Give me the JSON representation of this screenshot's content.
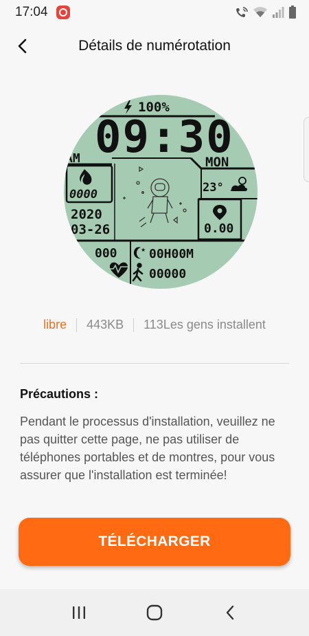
{
  "status_bar": {
    "time": "17:04",
    "icons": [
      "app-notification-icon",
      "wifi-calling-icon",
      "wifi-icon",
      "signal-icon",
      "battery-icon"
    ]
  },
  "app_bar": {
    "title": "Détails de numérotation",
    "back_icon": "chevron-left-icon"
  },
  "watch_face": {
    "battery": "100%",
    "time": "09:30",
    "ampm": "AM",
    "day": "MON",
    "calories": "0000",
    "temperature": "23°",
    "year": "2020",
    "date": "03-26",
    "distance": "0.00",
    "heart_rate": "000",
    "sleep": "00H00M",
    "steps": "00000"
  },
  "meta": {
    "price": "libre",
    "size": "443KB",
    "installs": "113Les gens installent"
  },
  "precautions": {
    "title": "Précautions :",
    "text": "Pendant le processus d'installation, veuillez ne pas quitter cette page, ne pas utiliser de téléphones portables et de montres, pour vous assurer que l'installation est terminée!"
  },
  "download_label": "TÉLÉCHARGER",
  "nav": {
    "icons": [
      "recents-icon",
      "home-icon",
      "back-icon"
    ]
  },
  "colors": {
    "accent": "#ff6a12",
    "price": "#e8711e",
    "watch_bg": "#a6cbb3"
  }
}
